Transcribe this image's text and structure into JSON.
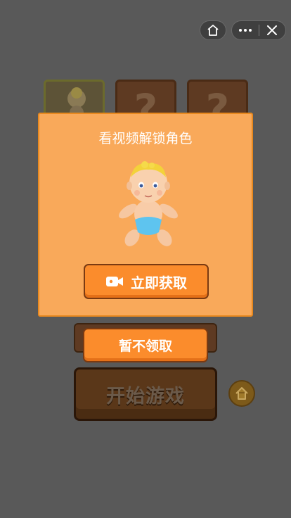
{
  "topbar": {
    "home_icon": "home-icon",
    "more_icon": "more-dots-icon",
    "close_icon": "close-icon"
  },
  "character_slots": [
    {
      "state": "selected",
      "icon": "baby-icon"
    },
    {
      "state": "locked",
      "symbol": "?"
    },
    {
      "state": "locked",
      "symbol": "?"
    }
  ],
  "dialog": {
    "title": "看视频解锁角色",
    "unlock_button": "立即获取",
    "unlock_icon": "video-camera-icon"
  },
  "skip_button": "暂不领取",
  "start_button": "开始游戏",
  "side_home_icon": "home-icon",
  "colors": {
    "overlay": "#595959",
    "dialog_bg": "#f9a95a",
    "button_orange": "#fb8c2c",
    "button_border": "#7a3a12"
  }
}
